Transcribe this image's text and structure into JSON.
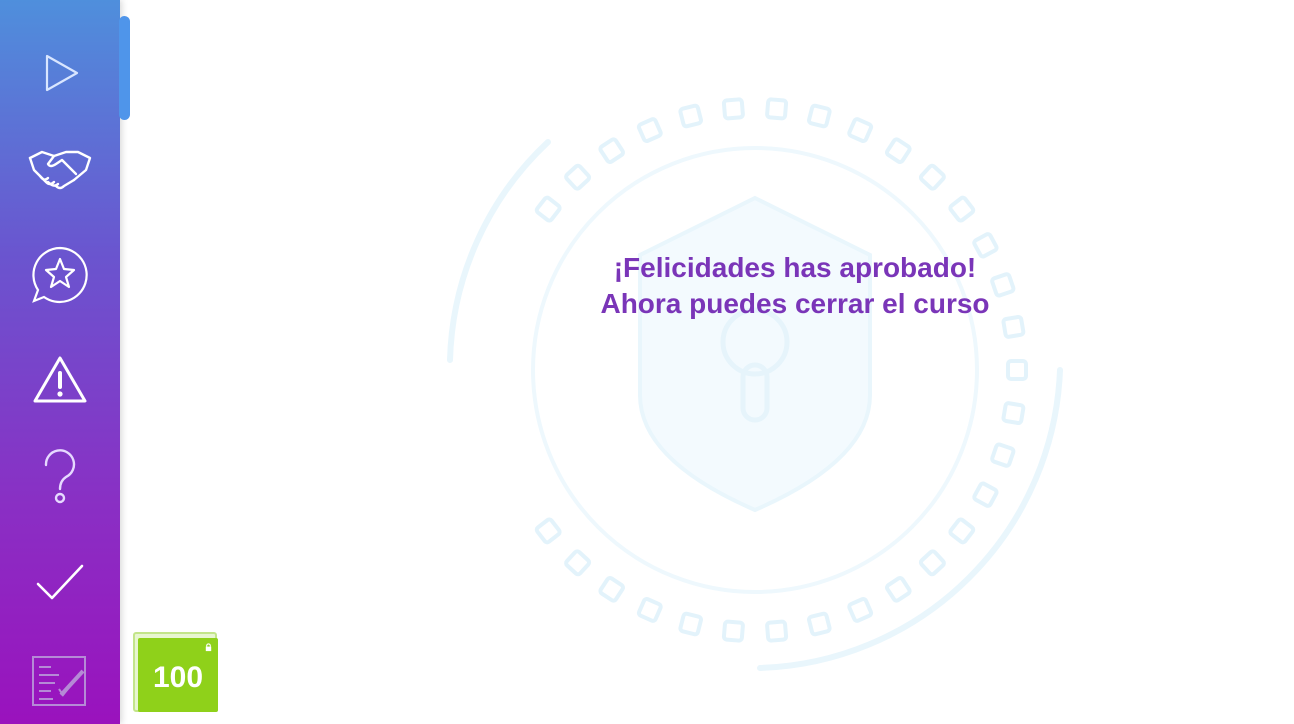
{
  "sidebar": {
    "items": [
      {
        "name": "play-icon",
        "label": "play"
      },
      {
        "name": "handshake-icon",
        "label": "handshake"
      },
      {
        "name": "star-bubble-icon",
        "label": "star chat"
      },
      {
        "name": "warning-icon",
        "label": "warning"
      },
      {
        "name": "question-icon",
        "label": "question"
      },
      {
        "name": "check-icon",
        "label": "check"
      },
      {
        "name": "checklist-document-icon",
        "label": "checklist"
      }
    ],
    "colors": {
      "top": "#4f8fdc",
      "bottom": "#9a12bd",
      "icon": "#ffffff"
    }
  },
  "main": {
    "message_line1": "¡Felicidades has aprobado!",
    "message_line2": "Ahora puedes cerrar el curso",
    "message_color": "#7a35b8"
  },
  "score": {
    "value": "100",
    "color": "#8fd11a",
    "lock_icon": "lock-icon"
  }
}
